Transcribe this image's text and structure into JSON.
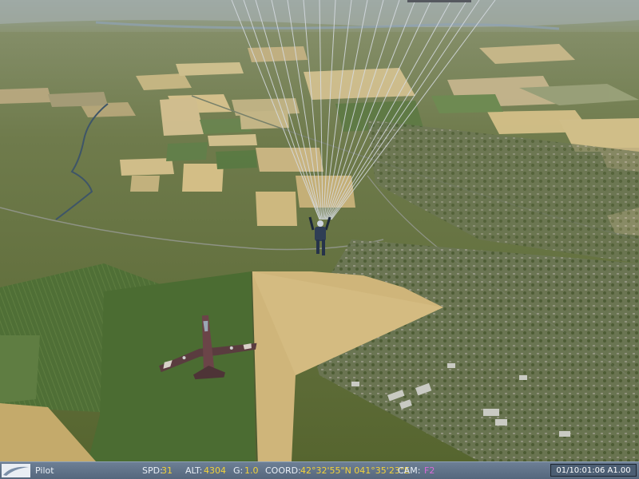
{
  "status_bar": {
    "view_label": "Pilot",
    "speed": {
      "label": "SPD:",
      "value": "31"
    },
    "altitude": {
      "label": "ALT:",
      "value": "4304"
    },
    "g_force": {
      "label": "G:",
      "value": "1.0"
    },
    "coordinates": {
      "label": "COORD:",
      "value": "42°32'55\"N 041°35'23\"E"
    },
    "camera": {
      "label": "CAM:",
      "value": "F2"
    },
    "clock": "01/10:01:06 A1.00"
  },
  "colors": {
    "status_bar_bg": "#5f718a",
    "value_yellow": "#f2d23a",
    "value_pink": "#d96ad8"
  },
  "scene": {
    "description_icons": [
      "parachutist-icon",
      "jet-aircraft-icon",
      "parachute-lines-icon"
    ]
  }
}
